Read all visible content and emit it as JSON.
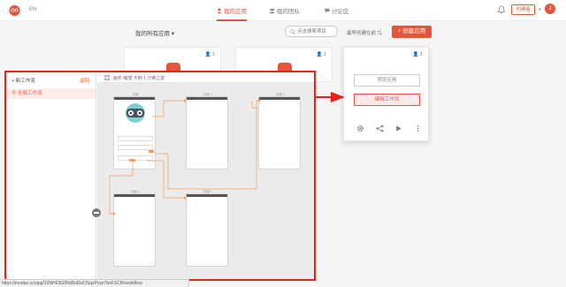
{
  "header": {
    "lang": "EN",
    "tabs": [
      {
        "label": "我的应用",
        "active": true
      },
      {
        "label": "我的团队",
        "active": false
      },
      {
        "label": "讨论区",
        "active": false
      }
    ],
    "create_label": "创建者",
    "avatar_letter": "J"
  },
  "toolbar": {
    "filter_label": "我的所有应用",
    "search_placeholder": "点击搜索项目",
    "sort_label": "最早创建在前",
    "new_app_label": "创建应用"
  },
  "cards": {
    "member_count": "1",
    "popup_count": "1",
    "preview_app_label": "预览应用",
    "edit_workflow_label": "编辑工作流"
  },
  "overlay": {
    "new_workflow_label": "新工作流",
    "back_label": "返回",
    "workflow_item_label": "全局工作流",
    "header_text": "画布 缩放  不到 1 分钟之前",
    "phone_titles": [
      "页面",
      "页面 1",
      "页面 1",
      "页面 1",
      "页面 1"
    ]
  },
  "status_url": "https://modao.cc/app/12NHF3G0Nd5sDlxOSqzPvye7bsFSCf6/workflow",
  "colors": {
    "accent": "#e5553c",
    "highlight": "#e8241a",
    "flow": "#f0a060"
  }
}
